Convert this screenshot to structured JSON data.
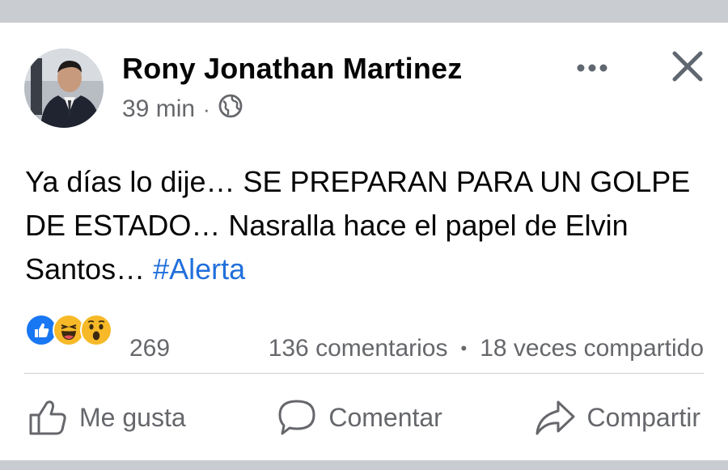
{
  "post": {
    "author": "Rony Jonathan Martinez",
    "time": "39 min",
    "separator": "·",
    "privacy_icon": "globe-icon",
    "text_before": "Ya días lo dije… SE PREPARAN PARA UN GOLPE DE ESTADO… Nasralla hace el papel de Elvin Santos… ",
    "hashtag": "#Alerta"
  },
  "header_icons": {
    "more": "more-options-icon",
    "close": "close-icon"
  },
  "engagement": {
    "reaction_icons": [
      "like-reaction-icon",
      "haha-reaction-icon",
      "wow-reaction-icon"
    ],
    "reaction_count": "269",
    "comments": "136 comentarios",
    "bullet": "•",
    "shares": "18 veces compartido"
  },
  "actions": {
    "like": "Me gusta",
    "comment": "Comentar",
    "share": "Compartir"
  },
  "colors": {
    "link": "#216fdb",
    "secondary_text": "#65676b",
    "like_blue": "#1877f2",
    "emoji_yellow": "#f7b928"
  }
}
